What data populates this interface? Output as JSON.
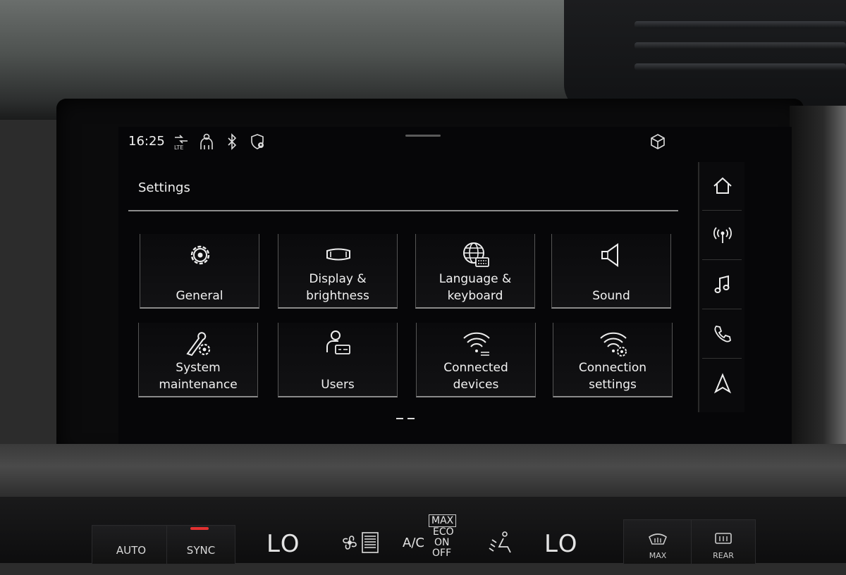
{
  "status": {
    "time": "16:25"
  },
  "header": {
    "title": "Settings"
  },
  "tiles": [
    {
      "label": "General",
      "icon": "gear-icon"
    },
    {
      "label": "Display &\nbrightness",
      "icon": "display-icon"
    },
    {
      "label": "Language &\nkeyboard",
      "icon": "globe-keyboard-icon"
    },
    {
      "label": "Sound",
      "icon": "speaker-icon"
    },
    {
      "label": "System\nmaintenance",
      "icon": "wrench-gear-icon"
    },
    {
      "label": "Users",
      "icon": "user-card-icon"
    },
    {
      "label": "Connected\ndevices",
      "icon": "wifi-devices-icon"
    },
    {
      "label": "Connection\nsettings",
      "icon": "wifi-gear-icon"
    }
  ],
  "rail": [
    {
      "icon": "home-icon"
    },
    {
      "icon": "radio-icon"
    },
    {
      "icon": "music-icon"
    },
    {
      "icon": "phone-icon"
    },
    {
      "icon": "navigation-icon"
    }
  ],
  "climate": {
    "auto": "AUTO",
    "sync": "SYNC",
    "temp_left": "LO",
    "temp_right": "LO",
    "ac": "A/C",
    "max": "MAX",
    "eco": "ECO",
    "on": "ON",
    "off": "OFF",
    "max_defrost": "MAX",
    "rear_defrost": "REAR"
  },
  "colors": {
    "screen_bg": "#060608",
    "text": "#f2f2f2",
    "divider": "#8c8c8c",
    "sync_led": "#e23030"
  }
}
